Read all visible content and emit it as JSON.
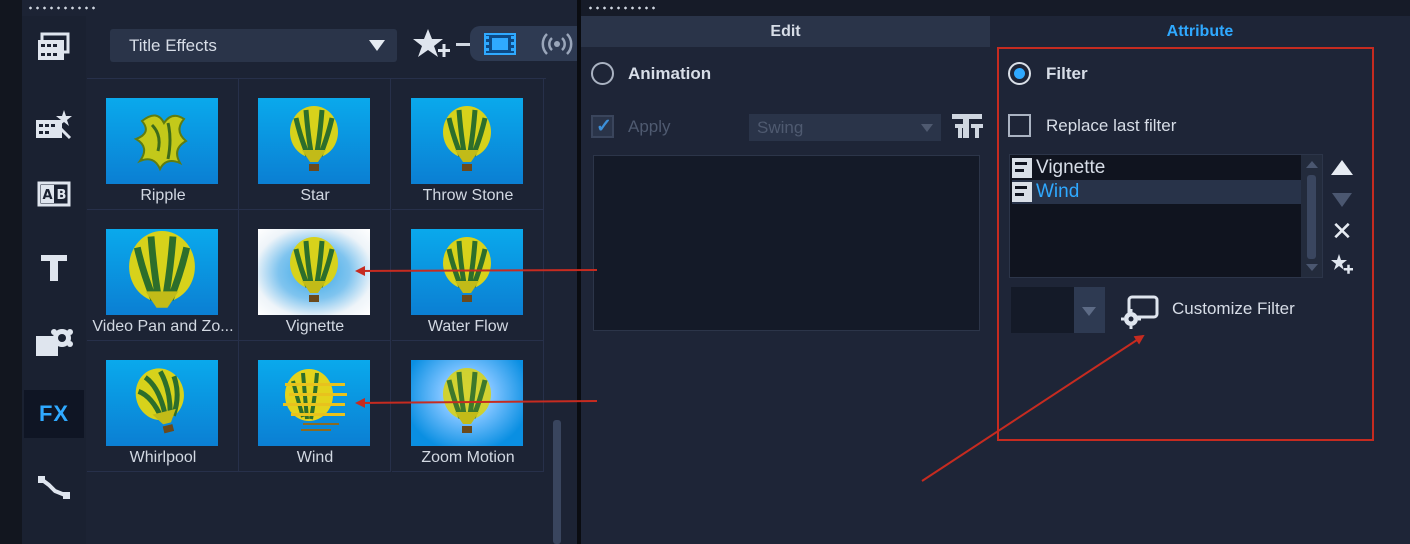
{
  "library": {
    "dropdown_label": "Title Effects",
    "tools": [
      {
        "name": "media-icon"
      },
      {
        "name": "instant-project-icon"
      },
      {
        "name": "transition-icon"
      },
      {
        "name": "title-icon"
      },
      {
        "name": "graphic-icon"
      },
      {
        "name": "filter-fx-icon",
        "label": "FX",
        "active": true
      },
      {
        "name": "path-icon"
      }
    ],
    "thumbnails": [
      {
        "label": "Ripple",
        "style": "ripple"
      },
      {
        "label": "Star",
        "style": "normal"
      },
      {
        "label": "Throw Stone",
        "style": "normal"
      },
      {
        "label": "Video Pan and Zo...",
        "style": "zoom"
      },
      {
        "label": "Vignette",
        "style": "vignette"
      },
      {
        "label": "Water Flow",
        "style": "normal"
      },
      {
        "label": "Whirlpool",
        "style": "tilted"
      },
      {
        "label": "Wind",
        "style": "wind"
      },
      {
        "label": "Zoom Motion",
        "style": "glow"
      }
    ]
  },
  "options": {
    "tabs": {
      "edit": "Edit",
      "attribute": "Attribute"
    },
    "edit": {
      "animation_label": "Animation",
      "apply_label": "Apply",
      "animation_preset": "Swing"
    },
    "attribute": {
      "filter_label": "Filter",
      "replace_last_filter_label": "Replace last filter",
      "applied_filters": [
        {
          "name": "Vignette",
          "selected": false
        },
        {
          "name": "Wind",
          "selected": true
        }
      ],
      "customize_filter_label": "Customize Filter"
    }
  },
  "colors": {
    "accent": "#2fa9ff",
    "annotation": "#c62b20",
    "panel": "#1e2537"
  }
}
